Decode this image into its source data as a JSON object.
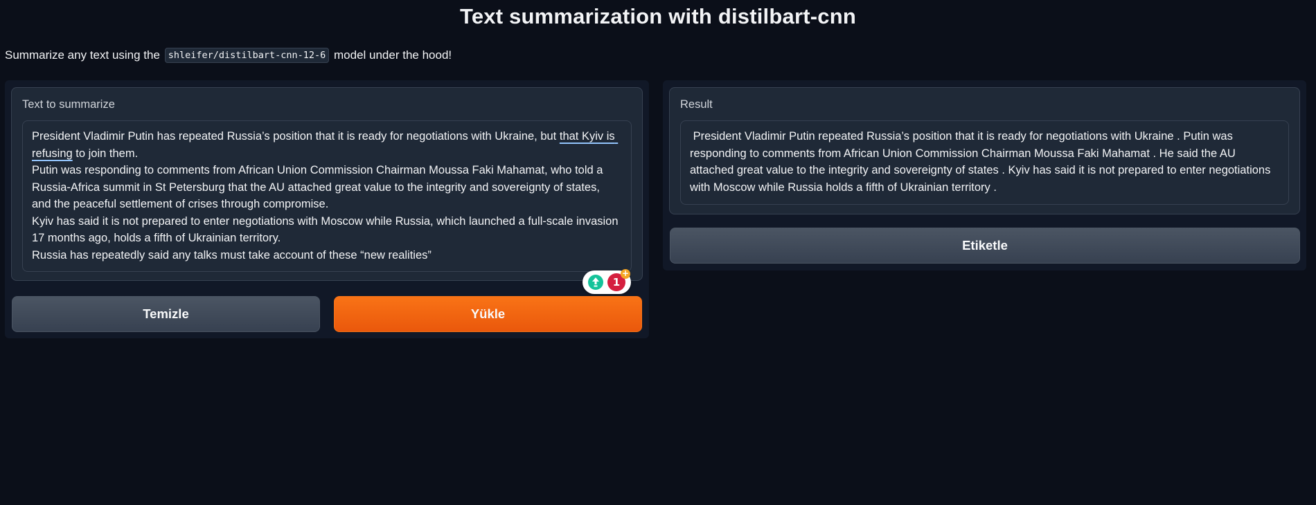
{
  "title": "Text summarization with distilbart-cnn",
  "description": {
    "prefix": "Summarize any text using the",
    "model": "shleifer/distilbart-cnn-12-6",
    "suffix": "model under the hood!"
  },
  "input": {
    "label": "Text to summarize",
    "text_line1_before": "President Vladimir Putin has repeated Russia’s position that it is ready for negotiations with Ukraine, but ",
    "text_line1_flagged": "that Kyiv is refusing",
    "text_line1_after": " to join them.",
    "text_para2": "Putin was responding to comments from African Union Commission Chairman Moussa Faki Mahamat, who told a Russia-Africa summit in St Petersburg that the AU attached great value to the integrity and sovereignty of states, and the peaceful settlement of crises through compromise.",
    "text_para3": "Kyiv has said it is not prepared to enter negotiations with Moscow while Russia, which launched a full-scale invasion 17 months ago, holds a fifth of Ukrainian territory.",
    "text_para4": "Russia has repeatedly said any talks must take account of these “new realities”"
  },
  "output": {
    "label": "Result",
    "text": " President Vladimir Putin repeated Russia’s position that it is ready for negotiations with Ukraine . Putin was responding to comments from African Union Commission Chairman Moussa Faki Mahamat . He said the AU attached great value to the integrity and sovereignty of states . Kyiv has said it is not prepared to enter negotiations with Moscow while Russia holds a fifth of Ukrainian territory ."
  },
  "grammarly": {
    "count": "1",
    "plus": "+",
    "icon": "grammarly-bulb-icon"
  },
  "buttons": {
    "clear": "Temizle",
    "submit": "Yükle",
    "flag": "Etiketle"
  },
  "colors": {
    "background": "#0b0f19",
    "panel": "#111827",
    "block": "#1f2937",
    "primary": "#f97316",
    "secondary": "#4b5563",
    "grammarly_green": "#15c39a",
    "grammarly_red": "#d51f3f"
  }
}
